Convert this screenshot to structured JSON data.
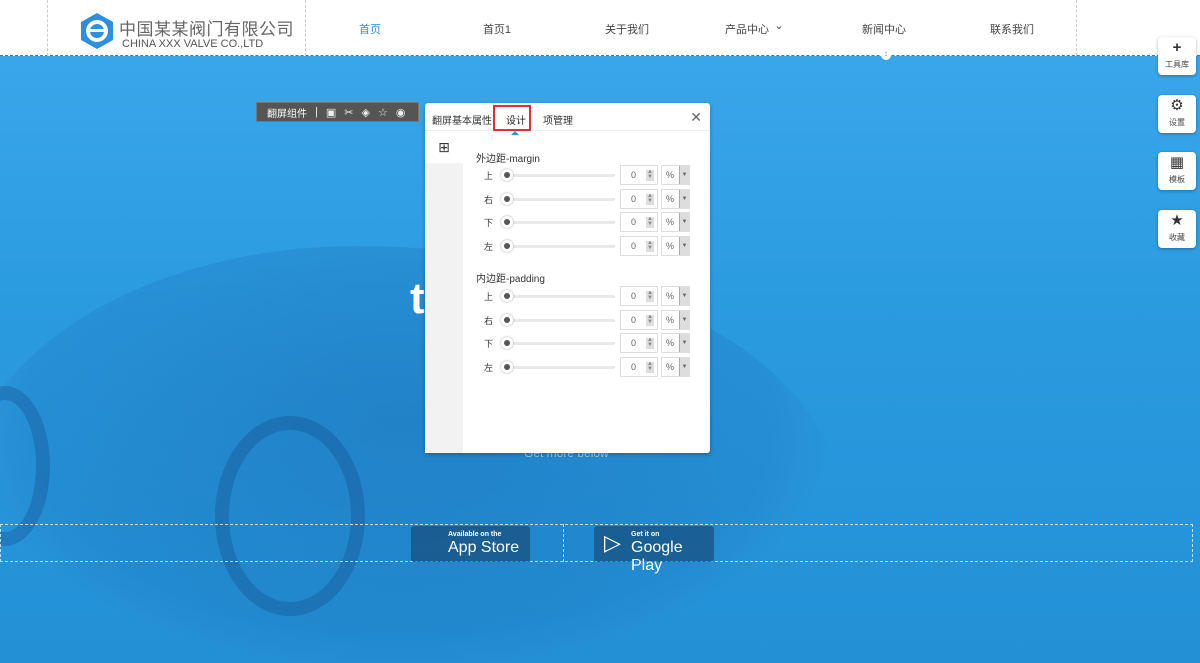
{
  "header": {
    "brand_cn": "中国某某阀门有限公司",
    "brand_en": "CHINA XXX VALVE CO.,LTD",
    "nav": [
      {
        "label": "首页"
      },
      {
        "label": "首页1"
      },
      {
        "label": "关于我们"
      },
      {
        "label": "产品中心"
      },
      {
        "label": "新闻中心"
      },
      {
        "label": "联系我们"
      }
    ]
  },
  "hero": {
    "title_fragment": "t",
    "sub": "Get more below"
  },
  "toolbar": {
    "label": "翻屏组件"
  },
  "dialog": {
    "tabs": [
      "翻屏基本属性",
      "设计",
      "项管理"
    ],
    "close": "✕",
    "margin": {
      "title": "外边距-margin",
      "rows": [
        {
          "label": "上",
          "value": "0",
          "unit": "%"
        },
        {
          "label": "右",
          "value": "0",
          "unit": "%"
        },
        {
          "label": "下",
          "value": "0",
          "unit": "%"
        },
        {
          "label": "左",
          "value": "0",
          "unit": "%"
        }
      ]
    },
    "padding": {
      "title": "内边距-padding",
      "rows": [
        {
          "label": "上",
          "value": "0",
          "unit": "%"
        },
        {
          "label": "右",
          "value": "0",
          "unit": "%"
        },
        {
          "label": "下",
          "value": "0",
          "unit": "%"
        },
        {
          "label": "左",
          "value": "0",
          "unit": "%"
        }
      ]
    }
  },
  "side": [
    {
      "label": "工具库",
      "icon": "plus-icon"
    },
    {
      "label": "设置",
      "icon": "gears-icon"
    },
    {
      "label": "模板",
      "icon": "grid-icon"
    },
    {
      "label": "收藏",
      "icon": "star-icon"
    }
  ],
  "stores": {
    "apple_small": "Available on the",
    "apple_big": "App Store",
    "google_small": "Get it on",
    "google_big": "Google Play"
  }
}
